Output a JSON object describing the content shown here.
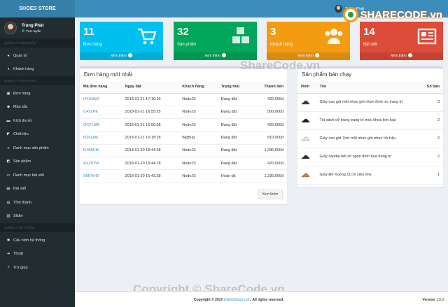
{
  "app": {
    "logo_text": "SHOES STORE"
  },
  "user": {
    "name": "Trung Phát",
    "status": "Trực tuyến"
  },
  "sidebar": {
    "sections": [
      {
        "title": "QUẢN LÝ TÀI KHOẢN",
        "items": [
          {
            "label": "Quản trị",
            "icon": "user-icon"
          },
          {
            "label": "Khách hàng",
            "icon": "users-icon"
          }
        ]
      },
      {
        "title": "QUẢN LÝ CỬA HÀNG",
        "items": [
          {
            "label": "Đơn hàng",
            "icon": "cart-icon"
          },
          {
            "label": "Màu sắc",
            "icon": "tint-icon"
          },
          {
            "label": "Kích thước",
            "icon": "ruler-icon"
          },
          {
            "label": "Chất liệu",
            "icon": "tag-icon"
          },
          {
            "label": "Danh mục sản phẩm",
            "icon": "list-icon"
          },
          {
            "label": "Sản phẩm",
            "icon": "cube-icon"
          },
          {
            "label": "Danh mục bài viết",
            "icon": "folder-icon"
          },
          {
            "label": "Bài viết",
            "icon": "newspaper-icon"
          },
          {
            "label": "Tỉnh thành",
            "icon": "globe-icon"
          },
          {
            "label": "Slider",
            "icon": "image-icon"
          }
        ]
      },
      {
        "title": "QUẢN LÝ HỆ THỐNG",
        "items": [
          {
            "label": "Cấu hình hệ thống",
            "icon": "gear-icon"
          },
          {
            "label": "Thoát",
            "icon": "signout-icon"
          },
          {
            "label": "Trợ giúp",
            "icon": "help-icon"
          }
        ]
      }
    ]
  },
  "topbar": {
    "user_name": "Trung Phát"
  },
  "watermark": {
    "brand": "SHARECODE.vn",
    "center": "ShareCode.vn",
    "bottom": "Copyright © ShareCode.vn"
  },
  "stats": [
    {
      "value": "11",
      "label": "Đơn hàng",
      "link": "Xem thêm",
      "color": "#00c0ef",
      "icon": "cart-icon"
    },
    {
      "value": "32",
      "label": "Sản phẩm",
      "link": "Xem thêm",
      "color": "#00a65a",
      "icon": "cubes-icon"
    },
    {
      "value": "3",
      "label": "Khách hàng",
      "link": "Xem thêm",
      "color": "#f39c12",
      "icon": "users-icon"
    },
    {
      "value": "14",
      "label": "Bài viết",
      "link": "Xem thêm",
      "color": "#dd4b39",
      "icon": "newspaper-icon"
    }
  ],
  "orders": {
    "title": "Đơn hàng mới nhất",
    "columns": [
      "Mã đơn hàng",
      "Ngày đặt",
      "Khách hàng",
      "Trạng thái",
      "Thành tiền"
    ],
    "rows": [
      [
        "HYHMU0",
        "2018-01-21 17:16:39",
        "NodeJS",
        "Đang đặt",
        "420,000đ"
      ],
      [
        "C4SLPE",
        "2018-01-21 16:55:25",
        "NodeJS",
        "Đang đặt",
        "500,000đ"
      ],
      [
        "OCFLMA",
        "2018-01-21 16:50:08",
        "NodeJS",
        "Đang đặt",
        "420,000đ"
      ],
      [
        "NZFQ86",
        "2018-01-21 16:18:28",
        "BigBug",
        "Đang đặt",
        "810,000đ"
      ],
      [
        "RJAMHK",
        "2018-01-20 18:44:38",
        "NodeJS",
        "Đang đặt",
        "1,280,000đ"
      ],
      [
        "AXZ8TW",
        "2018-01-20 18:44:18",
        "NodeJS",
        "Đang đặt",
        "420,000đ"
      ],
      [
        "SMV6H9",
        "2018-01-20 16:43:28",
        "NodeJS",
        "Hoàn tất",
        "1,330,000đ"
      ]
    ],
    "view_more": "Xem thêm"
  },
  "bestsellers": {
    "title": "Sản phẩm bán chạy",
    "columns": [
      "Hình",
      "Tên",
      "Số bán"
    ],
    "rows": [
      {
        "name": "Giày cao gót mũi nhọn gót nhọn đính nơ trang trí",
        "sold": "3",
        "color": "#3a3a3a"
      },
      {
        "name": "Túi xách cỡ trung trang trí móc khoá kim loại",
        "sold": "2",
        "color": "#1c1c1c"
      },
      {
        "name": "Giày cao gót 7cm mũi nhọn gót nhọn hở hậu",
        "sold": "2",
        "color": "#e8e4dc"
      },
      {
        "name": "Giày sandal bệt xỏ ngón đính hoa trang trí",
        "sold": "2",
        "color": "#2b2b2b"
      },
      {
        "name": "Giày Đế Xuồng 11cm siêu nhẹ",
        "sold": "1",
        "color": "#c97a4a"
      }
    ]
  },
  "footer": {
    "copyright_prefix": "Copyright © 2017",
    "link": "IzWebSmart.com",
    "suffix": ". All rights reserved.",
    "version_label": "Version",
    "version": "1.0.0"
  }
}
